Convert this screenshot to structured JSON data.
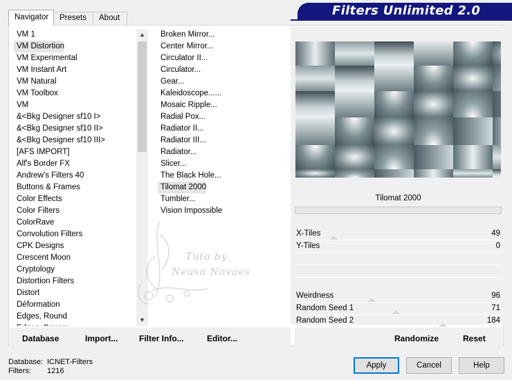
{
  "tabs": [
    {
      "label": "Navigator"
    },
    {
      "label": "Presets"
    },
    {
      "label": "About"
    }
  ],
  "banner": {
    "title": "Filters Unlimited 2.0",
    "color": "#12177d"
  },
  "categories": [
    "VM 1",
    "VM Distortion",
    "VM Experimental",
    "VM Instant Art",
    "VM Natural",
    "VM Toolbox",
    "VM",
    "&<Bkg Designer sf10 I>",
    "&<Bkg Designer sf10 II>",
    "&<Bkg Designer sf10 III>",
    "[AFS IMPORT]",
    "Alf's Border FX",
    "Andrew's Filters 40",
    "Buttons & Frames",
    "Color Effects",
    "Color Filters",
    "ColorRave",
    "Convolution Filters",
    "CPK Designs",
    "Crescent Moon",
    "Cryptology",
    "Distortion Filters",
    "Distort",
    "Déformation",
    "Edges, Round",
    "Edges, Square"
  ],
  "selected_category": "VM Distortion",
  "filters": [
    "Broken Mirror...",
    "Center Mirror...",
    "Circulator II...",
    "Circulator...",
    "Gear...",
    "Kaleidoscope......",
    "Mosaic Ripple...",
    "Radial Pox...",
    "Radiator II...",
    "Radiator III...",
    "Radiator...",
    "Slicer...",
    "The Black Hole...",
    "Tilomat 2000",
    "Tumbler...",
    "Vision Impossible"
  ],
  "selected_filter": "Tilomat 2000",
  "watermark": {
    "line1": "Tuto by_",
    "line2": "Neusa Novaes"
  },
  "preview": {
    "filter_name": "Tilomat 2000"
  },
  "params": [
    {
      "label": "X-Tiles",
      "value": "49"
    },
    {
      "label": "Y-Tiles",
      "value": "0"
    },
    {
      "label": "Weirdness",
      "value": "96"
    },
    {
      "label": "Random Seed 1",
      "value": "71"
    },
    {
      "label": "Random Seed 2",
      "value": "184"
    }
  ],
  "links": {
    "database": "Database",
    "import": "Import...",
    "filter_info": "Filter Info...",
    "editor": "Editor...",
    "randomize": "Randomize",
    "reset": "Reset"
  },
  "status": {
    "database_label": "Database:",
    "database_value": "ICNET-Filters",
    "filters_label": "Filters:",
    "filters_value": "1216"
  },
  "buttons": {
    "apply": "Apply",
    "cancel": "Cancel",
    "help": "Help"
  },
  "icons": {
    "scroll_up": "chevron-up-icon",
    "scroll_down": "chevron-down-icon"
  }
}
